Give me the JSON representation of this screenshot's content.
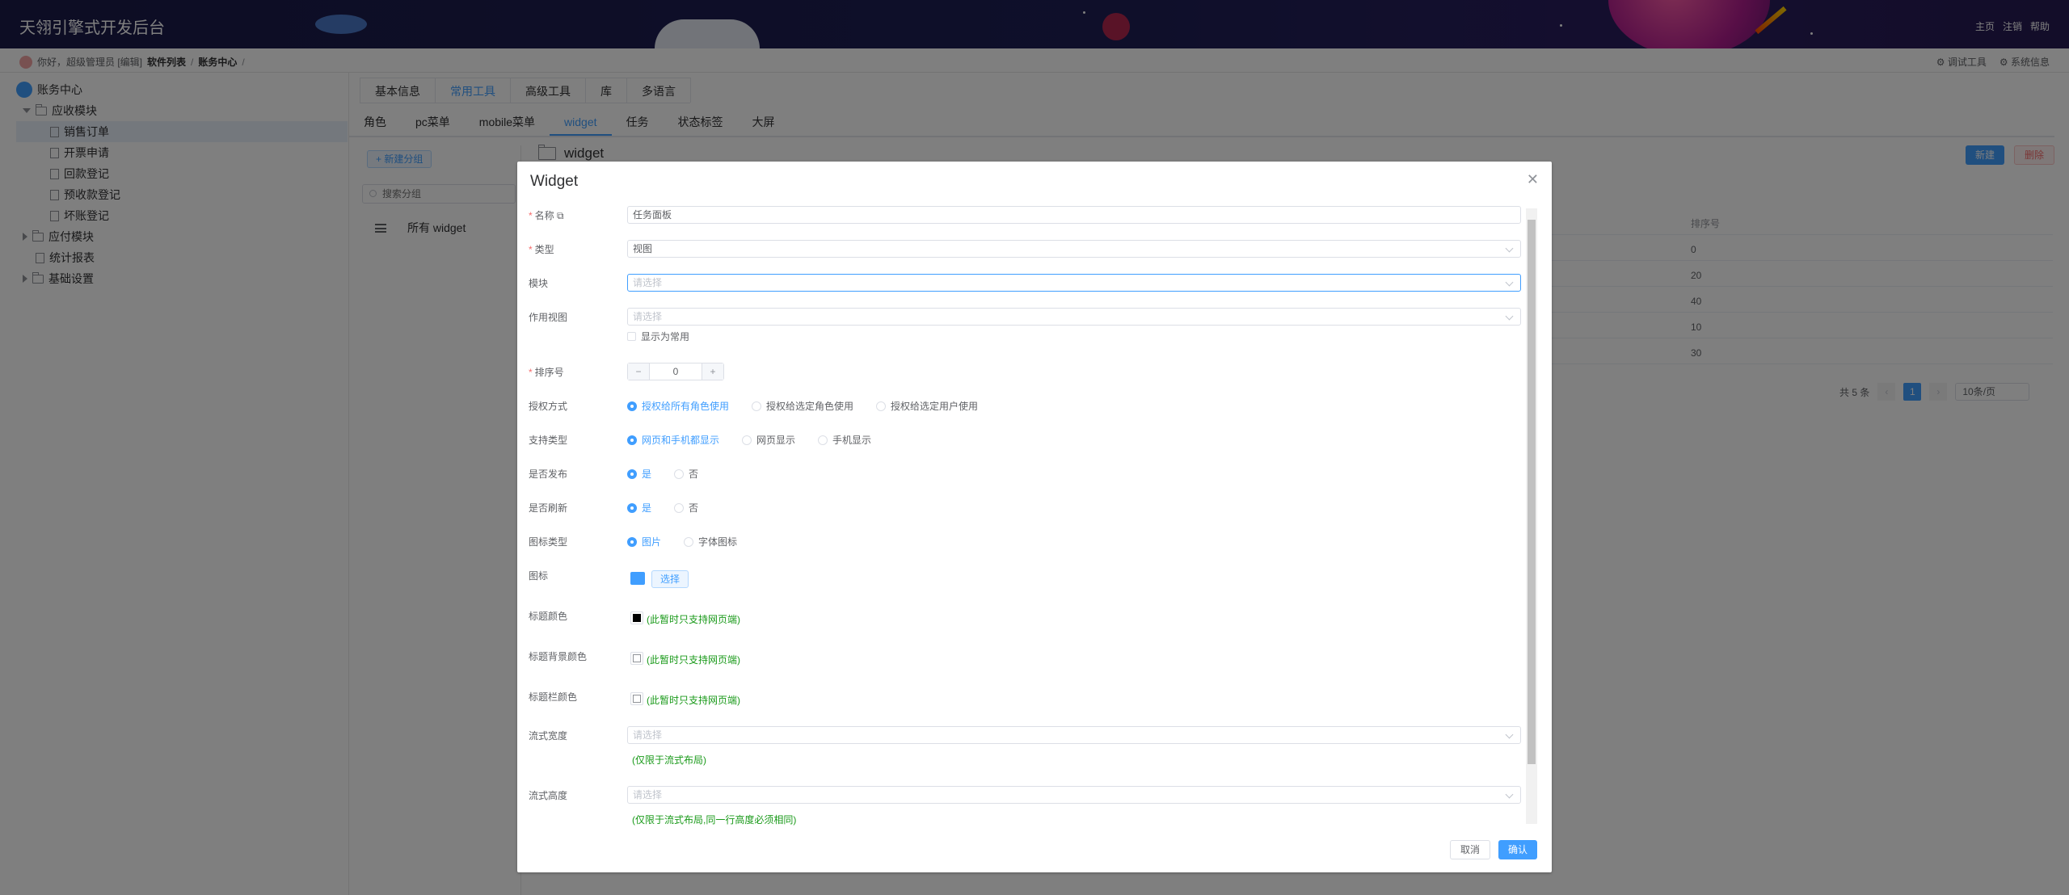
{
  "header": {
    "title": "天翎引擎式开发后台",
    "links": [
      "主页",
      "注销",
      "帮助"
    ]
  },
  "subbar": {
    "greeting": "你好，超级管理员 [编辑]",
    "crumbs": [
      "软件列表",
      "账务中心"
    ],
    "tools": [
      "调试工具",
      "系统信息"
    ]
  },
  "sidebar": {
    "root": "账务中心",
    "items": [
      {
        "label": "应收模块",
        "kind": "folder"
      },
      {
        "label": "销售订单",
        "kind": "doc"
      },
      {
        "label": "开票申请",
        "kind": "doc"
      },
      {
        "label": "回款登记",
        "kind": "doc"
      },
      {
        "label": "预收款登记",
        "kind": "doc"
      },
      {
        "label": "坏账登记",
        "kind": "doc"
      },
      {
        "label": "应付模块",
        "kind": "folder"
      },
      {
        "label": "统计报表",
        "kind": "doc"
      },
      {
        "label": "基础设置",
        "kind": "folder"
      }
    ]
  },
  "tabs_top": [
    "基本信息",
    "常用工具",
    "高级工具",
    "库",
    "多语言"
  ],
  "tabs_sub": [
    "角色",
    "pc菜单",
    "mobile菜单",
    "widget",
    "任务",
    "状态标签",
    "大屏"
  ],
  "left_panel": {
    "new_group": "+ 新建分组",
    "search_placeholder": "搜索分组",
    "all_widget": "所有 widget"
  },
  "content": {
    "folder_title": "widget",
    "new_button": "新建",
    "delete_button": "删除",
    "sort_header": "排序号",
    "sort_values": [
      "0",
      "20",
      "40",
      "10",
      "30"
    ],
    "pager": {
      "total": "共 5 条",
      "page": "1",
      "size": "10条/页"
    }
  },
  "dialog": {
    "title": "Widget",
    "fields": {
      "name": {
        "label": "名称",
        "value": "任务面板"
      },
      "type": {
        "label": "类型",
        "value": "视图"
      },
      "module": {
        "label": "模块",
        "placeholder": "请选择"
      },
      "view": {
        "label": "作用视图",
        "placeholder": "请选择"
      },
      "show_common": "显示为常用",
      "order": {
        "label": "排序号",
        "value": "0"
      },
      "auth": {
        "label": "授权方式",
        "options": [
          "授权给所有角色使用",
          "授权给选定角色使用",
          "授权给选定用户使用"
        ]
      },
      "support": {
        "label": "支持类型",
        "options": [
          "网页和手机都显示",
          "网页显示",
          "手机显示"
        ]
      },
      "publish": {
        "label": "是否发布",
        "options": [
          "是",
          "否"
        ]
      },
      "refresh": {
        "label": "是否刷新",
        "options": [
          "是",
          "否"
        ]
      },
      "icon_type": {
        "label": "图标类型",
        "options": [
          "图片",
          "字体图标"
        ]
      },
      "icon": {
        "label": "图标",
        "button": "选择"
      },
      "title_color": {
        "label": "标题颜色",
        "note": "(此暂时只支持网页端)",
        "color": "#000000"
      },
      "title_bg": {
        "label": "标题背景颜色",
        "note": "(此暂时只支持网页端)"
      },
      "title_bar": {
        "label": "标题栏颜色",
        "note": "(此暂时只支持网页端)"
      },
      "flow_width": {
        "label": "流式宽度",
        "placeholder": "请选择",
        "note": "(仅限于流式布局)"
      },
      "flow_height": {
        "label": "流式高度",
        "placeholder": "请选择",
        "note": "(仅限于流式布局,同一行高度必须相同)"
      }
    },
    "cancel": "取消",
    "confirm": "确认"
  },
  "colors": {
    "primary": "#409eff",
    "danger": "#f56c6c",
    "note_green": "#1a9a1a"
  }
}
